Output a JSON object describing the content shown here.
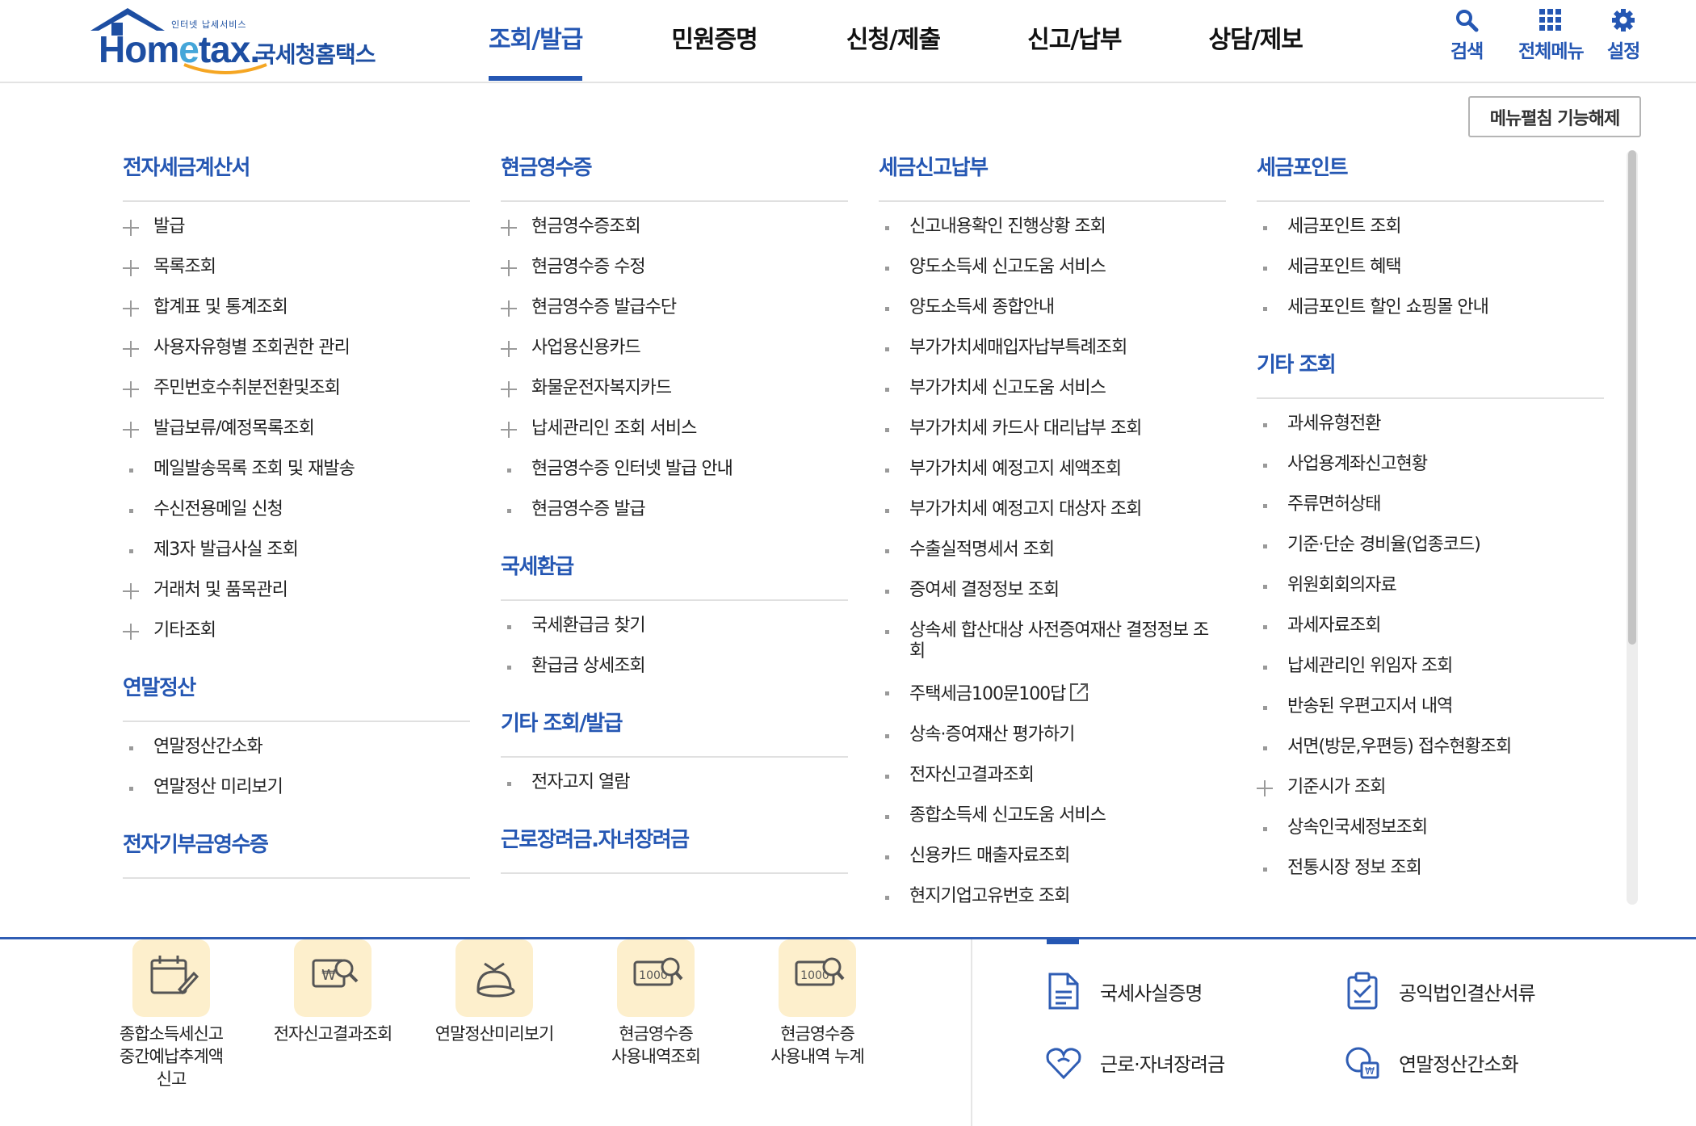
{
  "header": {
    "logo_small": "인터넷 납세서비스",
    "logo_main": "Hometax",
    "logo_sub": "국세청홈택스",
    "gnb": [
      "조회/발급",
      "민원증명",
      "신청/제출",
      "신고/납부",
      "상담/제보"
    ],
    "active_gnb": "조회/발급",
    "util": {
      "search": "검색",
      "all_menu": "전체메뉴",
      "settings": "설정"
    }
  },
  "colors": {
    "accent": "#2557b3",
    "quick_bg": "#fdefcc",
    "bullet": "#9a9a9a"
  },
  "toolbar": {
    "release_label": "메뉴펼침 기능해제"
  },
  "menu": {
    "col1": {
      "cat1": "전자세금계산서",
      "cat1_items": [
        "발급",
        "목록조회",
        "합계표 및 통계조회",
        "사용자유형별 조회권한 관리",
        "주민번호수취분전환및조회",
        "발급보류/예정목록조회",
        "메일발송목록 조회 및 재발송",
        "수신전용메일 신청",
        "제3자 발급사실 조회",
        "거래처 및 품목관리",
        "기타조회"
      ],
      "cat2": "연말정산",
      "cat2_items": [
        "연말정산간소화",
        "연말정산 미리보기"
      ],
      "cat3": "전자기부금영수증"
    },
    "col2": {
      "cat1": "현금영수증",
      "cat1_items": [
        "현금영수증조회",
        "현금영수증 수정",
        "현금영수증 발급수단",
        "사업용신용카드",
        "화물운전자복지카드",
        "납세관리인 조회 서비스",
        "현금영수증 인터넷 발급 안내",
        "현금영수증 발급"
      ],
      "cat2": "국세환급",
      "cat2_items": [
        "국세환급금 찾기",
        "환급금 상세조회"
      ],
      "cat3": "기타 조회/발급",
      "cat3_items": [
        "전자고지 열람"
      ],
      "cat4": "근로장려금.자녀장려금"
    },
    "col3": {
      "cat1": "세금신고납부",
      "cat1_items": [
        "신고내용확인 진행상황 조회",
        "양도소득세 신고도움 서비스",
        "양도소득세 종합안내",
        "부가가치세매입자납부특례조회",
        "부가가치세 신고도움 서비스",
        "부가가치세 카드사 대리납부 조회",
        "부가가치세 예정고지 세액조회",
        "부가가치세 예정고지 대상자 조회",
        "수출실적명세서 조회",
        "증여세 결정정보 조회",
        "상속세 합산대상 사전증여재산 결정정보 조회",
        "주택세금100문100답",
        "상속·증여재산 평가하기",
        "전자신고결과조회",
        "종합소득세 신고도움 서비스",
        "신용카드 매출자료조회",
        "현지기업고유번호 조회"
      ]
    },
    "col4": {
      "cat1": "세금포인트",
      "cat1_items": [
        "세금포인트 조회",
        "세금포인트 혜택",
        "세금포인트 할인 쇼핑몰 안내"
      ],
      "cat2": "기타 조회",
      "cat2_items": [
        "과세유형전환",
        "사업용계좌신고현황",
        "주류면허상태",
        "기준·단순 경비율(업종코드)",
        "위원회회의자료",
        "과세자료조회",
        "납세관리인 위임자 조회",
        "반송된 우편고지서 내역",
        "서면(방문,우편등) 접수현황조회",
        "기준시가 조회",
        "상속인국세정보조회",
        "전통시장 정보 조회"
      ]
    }
  },
  "quick": {
    "q1_l1": "종합소득세신고",
    "q1_l2": "중간예납추계액",
    "q1_l3": "신고",
    "q2": "전자신고결과조회",
    "q3": "연말정산미리보기",
    "q4_l1": "현금영수증",
    "q4_l2": "사용내역조회",
    "q5_l1": "현금영수증",
    "q5_l2": "사용내역 누계",
    "receipt_number": "1000"
  },
  "services": {
    "s1": "국세사실증명",
    "s2": "공익법인결산서류",
    "s3": "근로·자녀장려금",
    "s4": "연말정산간소화"
  }
}
